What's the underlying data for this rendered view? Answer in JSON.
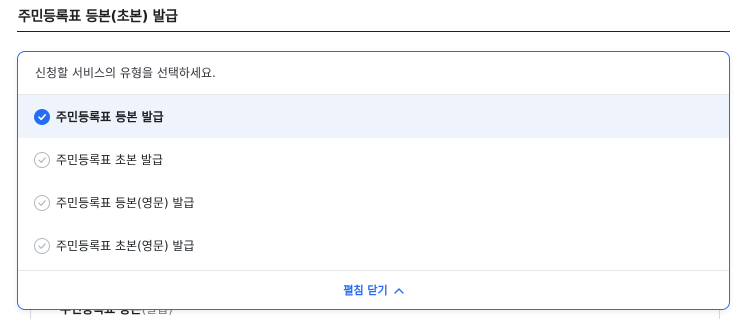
{
  "page": {
    "title": "주민등록표 등본(초본) 발급"
  },
  "panel": {
    "guide_text": "신청할 서비스의 유형을 선택하세요.",
    "options": [
      {
        "label": "주민등록표 등본 발급",
        "selected": true
      },
      {
        "label": "주민등록표 초본 발급",
        "selected": false
      },
      {
        "label": "주민등록표 등본(영문) 발급",
        "selected": false
      },
      {
        "label": "주민등록표 초본(영문) 발급",
        "selected": false
      }
    ],
    "collapse_label": "펼침 닫기",
    "collapse_icon": "chevron-up-icon"
  },
  "underlying": {
    "item_label": "주민등록표 등본",
    "item_sub": "(발급)"
  },
  "colors": {
    "accent": "#256ef4",
    "selected_bg": "#eef3fc",
    "text": "#1e2124",
    "muted_check": "#b1b8be"
  }
}
